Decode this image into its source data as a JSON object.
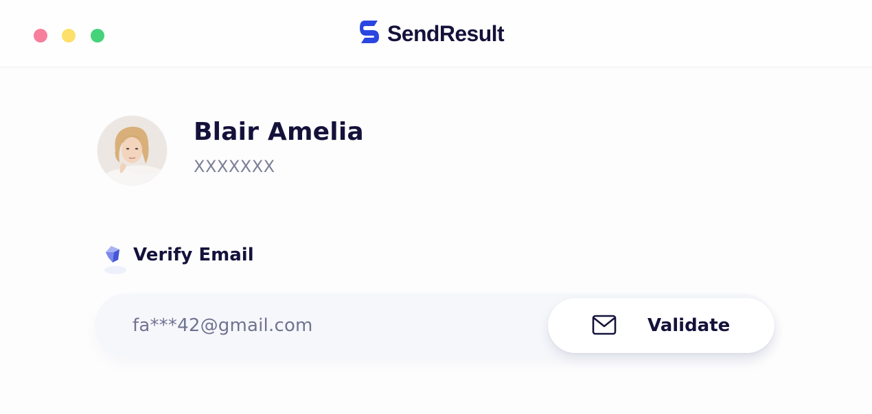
{
  "window": {
    "traffic_lights": {
      "close_color": "#f77f9c",
      "minimize_color": "#fde06a",
      "maximize_color": "#45d37a"
    }
  },
  "brand": {
    "name": "SendResult",
    "logo_icon": "sendresult-logo-icon",
    "accent": "#2a45e0"
  },
  "profile": {
    "avatar_icon": "avatar",
    "name": "Blair Amelia",
    "subtitle": "XXXXXXX"
  },
  "verify": {
    "title": "Verify Email",
    "icon": "gem-icon",
    "email_value": "fa***42@gmail.com",
    "button": {
      "label": "Validate",
      "icon": "mail-icon"
    }
  },
  "colors": {
    "text_primary": "#14123a",
    "text_secondary": "#7b7f97",
    "input_background": "#f6f7fb",
    "button_background": "#ffffff"
  }
}
